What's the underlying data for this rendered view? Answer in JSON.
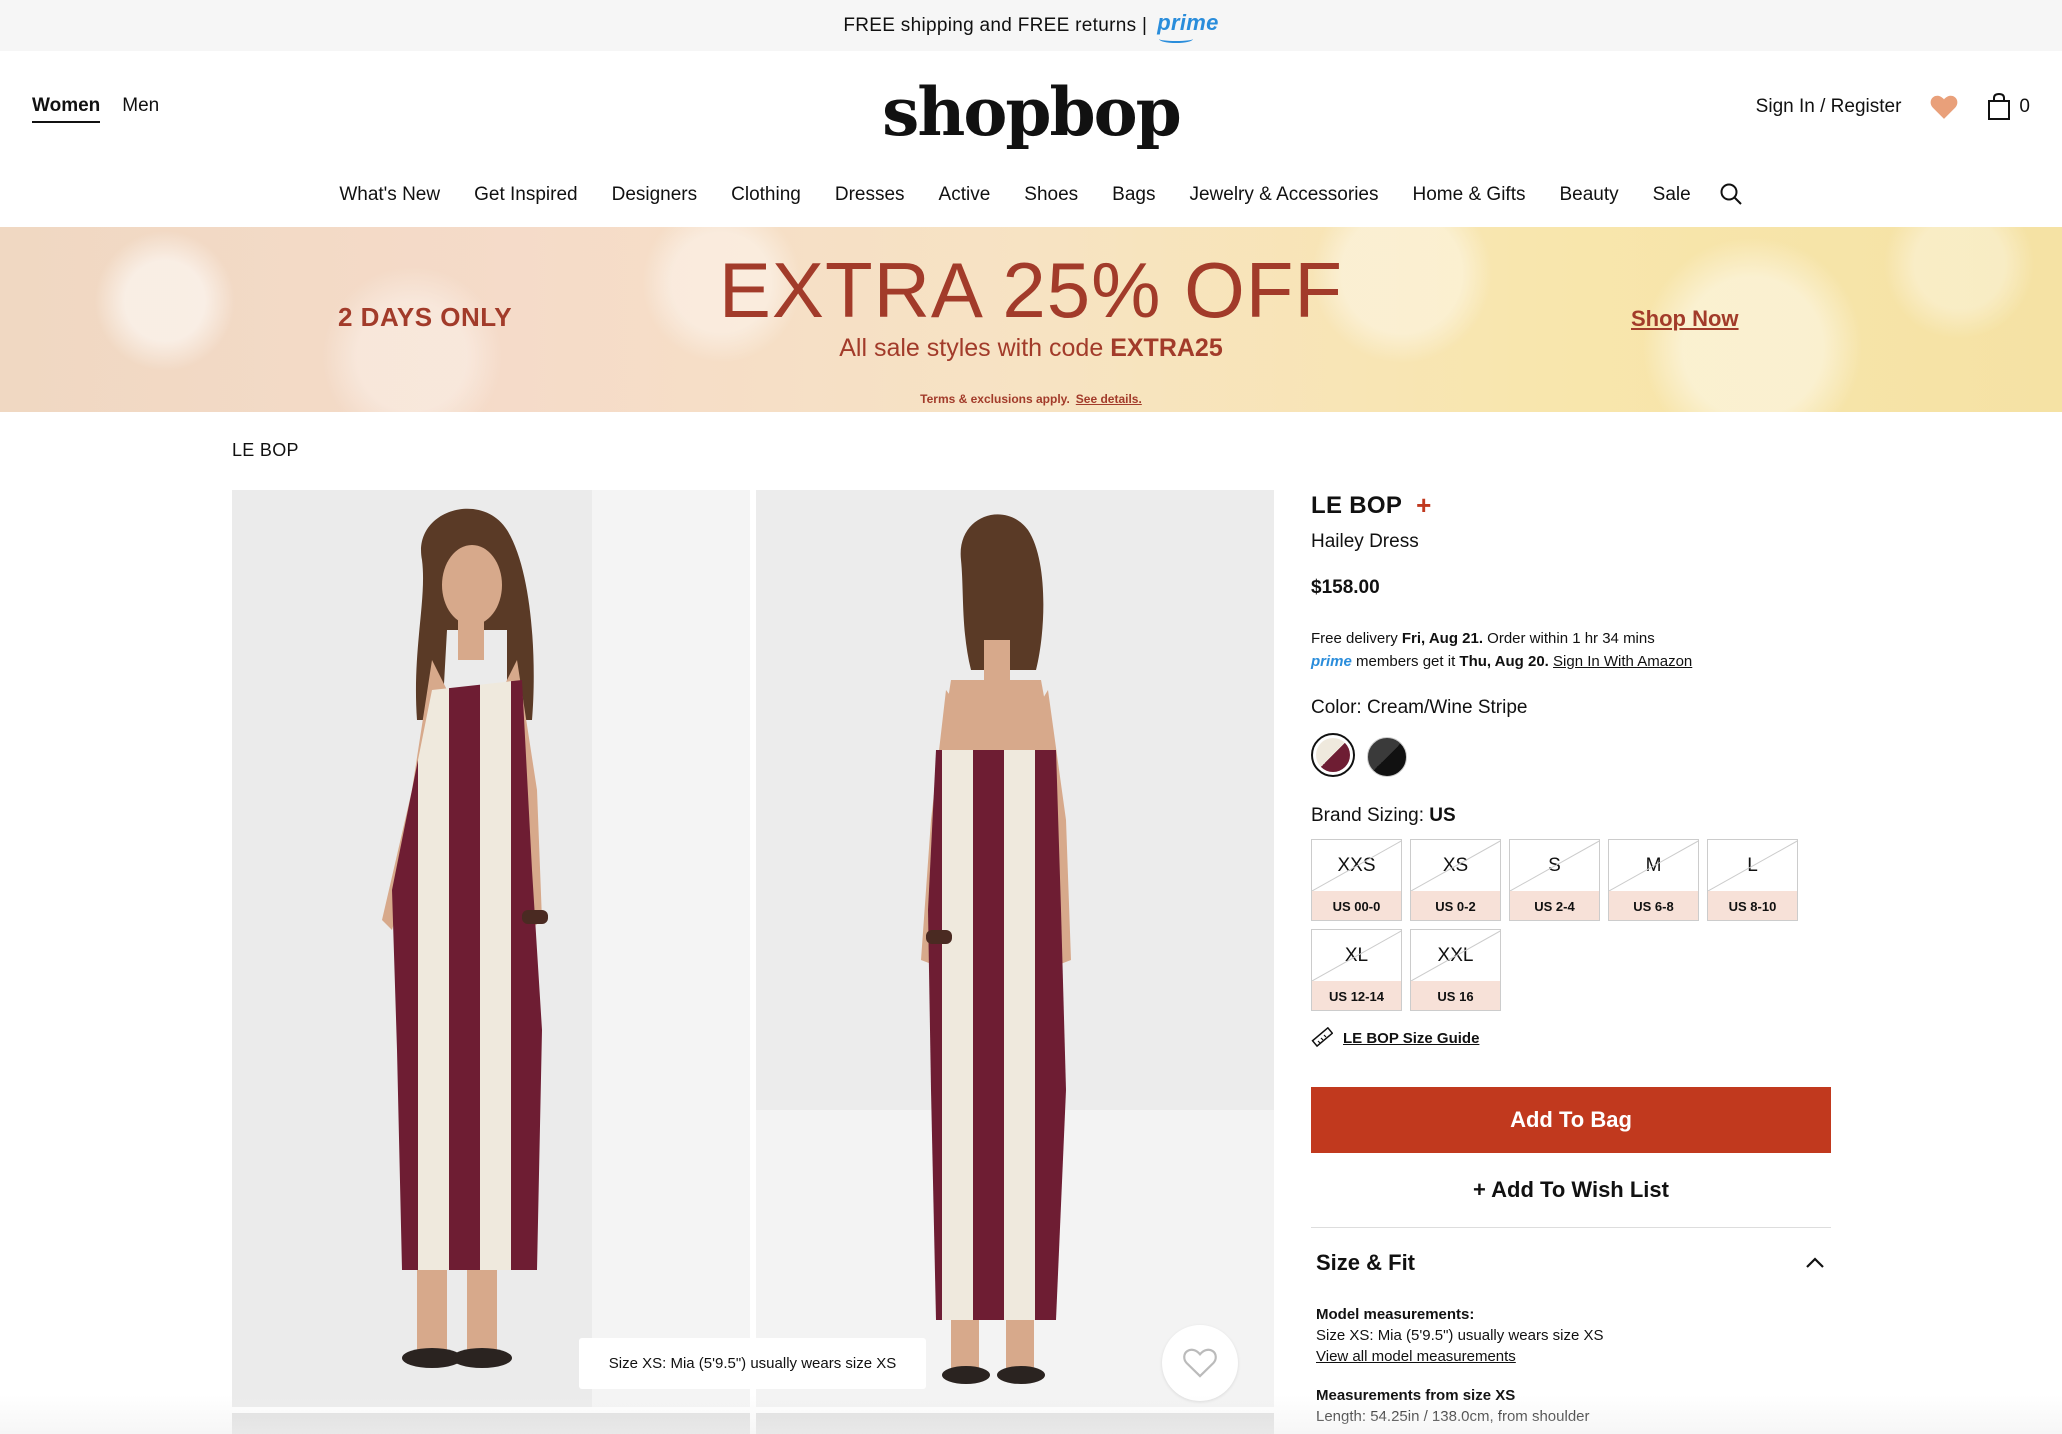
{
  "promo": {
    "text": "FREE shipping and FREE returns |",
    "prime": "prime"
  },
  "header": {
    "gender": [
      "Women",
      "Men"
    ],
    "logo": "shopbop",
    "sign_in": "Sign In / Register",
    "bag_count": "0",
    "nav": [
      "What's New",
      "Get Inspired",
      "Designers",
      "Clothing",
      "Dresses",
      "Active",
      "Shoes",
      "Bags",
      "Jewelry & Accessories",
      "Home & Gifts",
      "Beauty",
      "Sale"
    ]
  },
  "banner": {
    "days": "2 DAYS ONLY",
    "headline": "EXTRA 25% OFF",
    "sub_prefix": "All sale styles with code",
    "code": "EXTRA25",
    "terms": "Terms & exclusions apply.",
    "see_details": "See details.",
    "cta": "Shop Now",
    "color": "#a23b2a"
  },
  "breadcrumb": "LE BOP",
  "gallery": {
    "caption": "Size XS: Mia (5'9.5\") usually wears size XS",
    "stripe_color": "#6e1d33",
    "base_color": "#efe9dd"
  },
  "product": {
    "brand": "LE BOP",
    "name": "Hailey Dress",
    "price": "$158.00",
    "delivery_prefix": "Free delivery",
    "delivery_date": "Fri, Aug 21.",
    "delivery_suffix": "Order within 1 hr 34 mins",
    "prime_label": "prime",
    "prime_prefix": "members get it",
    "prime_date": "Thu, Aug 20.",
    "prime_link": "Sign In With Amazon",
    "color_label": "Color: Cream/Wine Stripe",
    "size_label": "Brand Sizing:",
    "size_system": "US",
    "sizes": [
      {
        "size": "XXS",
        "us": "US 00-0",
        "available": false
      },
      {
        "size": "XS",
        "us": "US 0-2",
        "available": false
      },
      {
        "size": "S",
        "us": "US 2-4",
        "available": false
      },
      {
        "size": "M",
        "us": "US 6-8",
        "available": false
      },
      {
        "size": "L",
        "us": "US 8-10",
        "available": false
      },
      {
        "size": "XL",
        "us": "US 12-14",
        "available": false
      },
      {
        "size": "XXL",
        "us": "US 16",
        "available": false
      }
    ],
    "size_guide": "LE BOP Size Guide",
    "add_to_bag": "Add To Bag",
    "wish_list": "+ Add To Wish List",
    "accent": "#c1391e"
  },
  "size_fit": {
    "title": "Size & Fit",
    "model_heading": "Model measurements:",
    "model_text": "Size XS: Mia (5'9.5\") usually wears size XS",
    "model_link": "View all model measurements",
    "measure_heading": "Measurements from size XS",
    "measure_text": "Length: 54.25in / 138.0cm, from shoulder"
  }
}
